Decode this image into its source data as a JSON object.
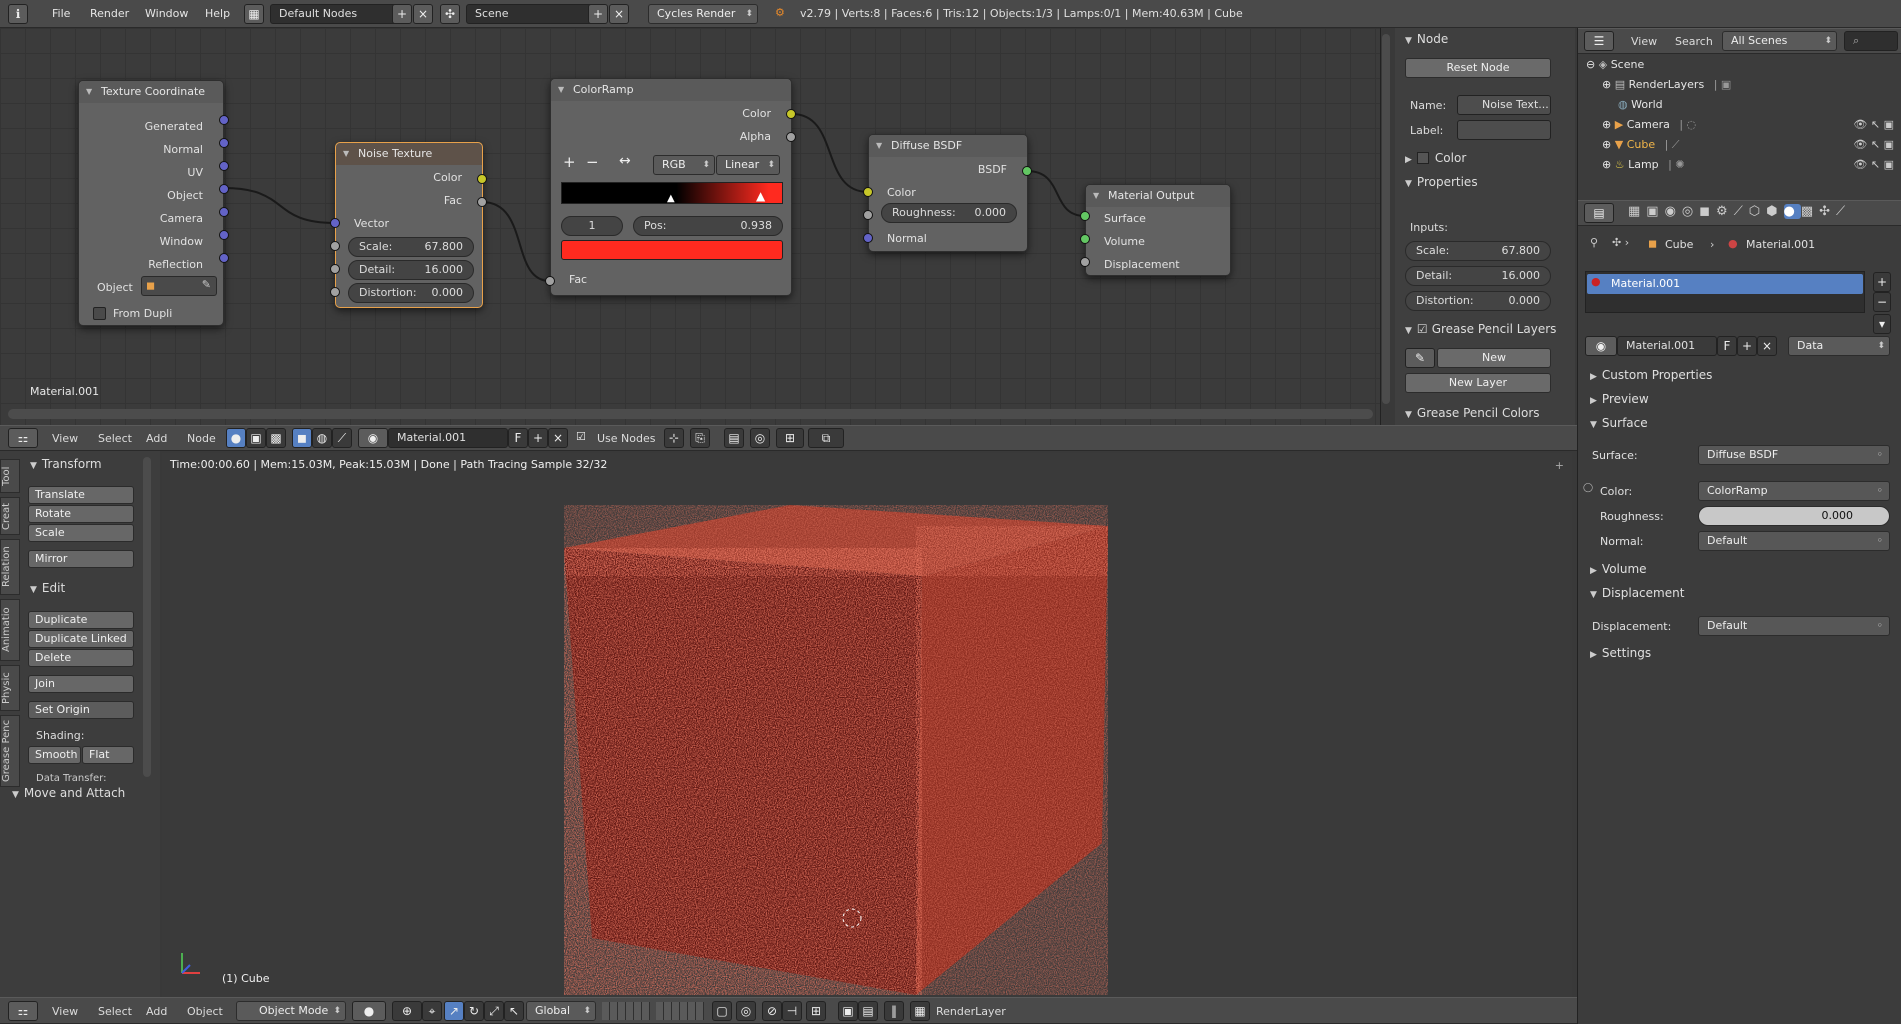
{
  "topbar": {
    "menus": [
      "File",
      "Render",
      "Window",
      "Help"
    ],
    "layout": "Default Nodes",
    "scene": "Scene",
    "engine": "Cycles Render",
    "stats": "v2.79 | Verts:8 | Faces:6 | Tris:12 | Objects:1/3 | Lamps:0/1 | Mem:40.63M | Cube"
  },
  "nodes": {
    "texcoord": {
      "title": "Texture Coordinate",
      "outputs": [
        "Generated",
        "Normal",
        "UV",
        "Object",
        "Camera",
        "Window",
        "Reflection"
      ],
      "object_label": "Object",
      "from_dupli": "From Dupli"
    },
    "noise": {
      "title": "Noise Texture",
      "outputs": [
        "Color",
        "Fac"
      ],
      "input": "Vector",
      "scale": "Scale:",
      "scale_v": "67.800",
      "detail": "Detail:",
      "detail_v": "16.000",
      "distortion": "Distortion:",
      "distortion_v": "0.000"
    },
    "ramp": {
      "title": "ColorRamp",
      "outputs": [
        "Color",
        "Alpha"
      ],
      "mode": "RGB",
      "interp": "Linear",
      "index": "1",
      "pos": "Pos:",
      "pos_v": "0.938",
      "input": "Fac"
    },
    "diffuse": {
      "title": "Diffuse BSDF",
      "output": "BSDF",
      "color": "Color",
      "rough": "Roughness:",
      "rough_v": "0.000",
      "normal": "Normal"
    },
    "output": {
      "title": "Material Output",
      "inputs": [
        "Surface",
        "Volume",
        "Displacement"
      ]
    },
    "material_label": "Material.001"
  },
  "node_panel": {
    "node": "Node",
    "reset": "Reset Node",
    "name_label": "Name:",
    "name_val": "Noise Text...",
    "label_label": "Label:",
    "color": "Color",
    "properties": "Properties",
    "inputs": "Inputs:",
    "scale": "Scale:",
    "scale_v": "67.800",
    "detail": "Detail:",
    "detail_v": "16.000",
    "distortion": "Distortion:",
    "distortion_v": "0.000",
    "gp_layers": "Grease Pencil Layers",
    "new": "New",
    "new_layer": "New Layer",
    "gp_colors": "Grease Pencil Colors"
  },
  "node_header": {
    "menus": [
      "View",
      "Select",
      "Add",
      "Node"
    ],
    "material": "Material.001",
    "f": "F",
    "use_nodes": "Use Nodes"
  },
  "tool": {
    "tabs": [
      "Tool",
      "Creat",
      "Relation",
      "Animatio",
      "Physic",
      "Grease Penc"
    ],
    "transform": "Transform",
    "translate": "Translate",
    "rotate": "Rotate",
    "scale": "Scale",
    "mirror": "Mirror",
    "edit": "Edit",
    "duplicate": "Duplicate",
    "dup_linked": "Duplicate Linked",
    "delete": "Delete",
    "join": "Join",
    "set_origin": "Set Origin",
    "shading": "Shading:",
    "smooth": "Smooth",
    "flat": "Flat",
    "data_transfer": "Data Transfer:",
    "move_attach": "Move and Attach"
  },
  "viewport": {
    "status": "Time:00:00.60 | Mem:15.03M, Peak:15.03M | Done | Path Tracing Sample 32/32",
    "object": "(1) Cube"
  },
  "bottom": {
    "menus": [
      "View",
      "Select",
      "Add",
      "Object"
    ],
    "mode": "Object Mode",
    "orientation": "Global",
    "layer": "RenderLayer"
  },
  "outliner": {
    "menus": [
      "View",
      "Search"
    ],
    "filter": "All Scenes",
    "items": [
      "Scene",
      "RenderLayers",
      "World",
      "Camera",
      "Cube",
      "Lamp"
    ]
  },
  "props": {
    "crumb_obj": "Cube",
    "crumb_mat": "Material.001",
    "slot": "Material.001",
    "mat_field": "Material.001",
    "f": "F",
    "data": "Data",
    "sections": [
      "Custom Properties",
      "Preview",
      "Surface"
    ],
    "surface_label": "Surface:",
    "surface_val": "Diffuse BSDF",
    "color_label": "Color:",
    "color_val": "ColorRamp",
    "rough_label": "Roughness:",
    "rough_val": "0.000",
    "normal_label": "Normal:",
    "normal_val": "Default",
    "volume": "Volume",
    "displacement": "Displacement",
    "disp_label": "Displacement:",
    "disp_val": "Default",
    "settings": "Settings"
  },
  "colors": {
    "accent": "#5680c2",
    "ramp_red": "#ff2a1f",
    "cube": "#7a2018"
  }
}
